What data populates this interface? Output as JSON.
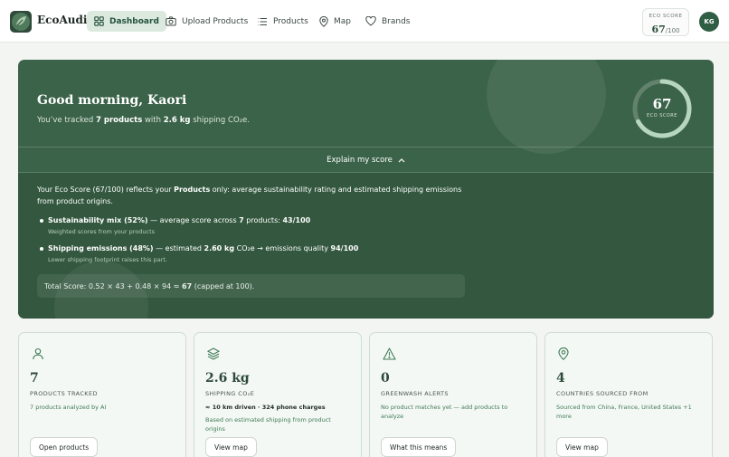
{
  "app": {
    "name": "EcoAudit"
  },
  "nav": {
    "items": [
      {
        "label": "Dashboard",
        "icon": "grid-icon",
        "active": true
      },
      {
        "label": "Upload Products",
        "icon": "camera-icon",
        "active": false
      },
      {
        "label": "Products",
        "icon": "list-icon",
        "active": false
      },
      {
        "label": "Map",
        "icon": "map-pin-icon",
        "active": false
      },
      {
        "label": "Brands",
        "icon": "heart-icon",
        "active": false
      }
    ],
    "eco_score": {
      "label": "ECO SCORE",
      "value": "67",
      "max": "/100"
    },
    "avatar_initials": "KG"
  },
  "hero": {
    "greeting": "Good morning, Kaori",
    "tracked_prefix": "You’ve tracked",
    "tracked_products": "7 products",
    "tracked_middle": "with",
    "tracked_co2": "2.6 kg",
    "tracked_suffix": "shipping CO₂e.",
    "score_value": 67,
    "score_max": 100,
    "score_label": "ECO SCORE",
    "explain_label": "Explain my score",
    "summary_1": "Your Eco Score (67/100) reflects your",
    "summary_bold": "Products",
    "summary_2": "only: average sustainability rating and estimated shipping emissions from product origins.",
    "bullet1": {
      "title": "Sustainability mix (52%)",
      "text_1": "— average score across",
      "count": "7",
      "text_2": "products:",
      "score": "43/100",
      "sub": "Weighted scores from your products"
    },
    "bullet2": {
      "title": "Shipping emissions (48%)",
      "text_1": "— estimated",
      "amount": "2.60 kg",
      "text_2": "CO₂e → emissions quality",
      "score": "94/100",
      "sub": "Lower shipping footprint raises this part."
    },
    "total_1": "Total Score: 0.52 × 43 + 0.48 × 94 ≈",
    "total_bold": "67",
    "total_2": "(capped at 100)."
  },
  "cards": [
    {
      "value": "7",
      "caption": "PRODUCTS TRACKED",
      "desc": "7 products analyzed by AI",
      "button": "Open products",
      "icon": "person-icon"
    },
    {
      "value": "2.6 kg",
      "caption": "SHIPPING CO₂E",
      "strong": "≈ 10 km driven · 324 phone charges",
      "desc": "Based on estimated shipping from product origins",
      "button": "View map",
      "icon": "layers-icon"
    },
    {
      "value": "0",
      "caption": "GREENWASH ALERTS",
      "desc": "No product matches yet — add products to analyze",
      "button": "What this means",
      "icon": "warning-icon"
    },
    {
      "value": "4",
      "caption": "COUNTRIES SOURCED FROM",
      "desc": "Sourced from China, France, United States +1 more",
      "button": "View map",
      "icon": "map-pin-icon"
    }
  ],
  "colors": {
    "primary": "#3b6349",
    "panel": "#33583f",
    "accent_light": "#dce9df",
    "ring": "#b7d6bf"
  }
}
